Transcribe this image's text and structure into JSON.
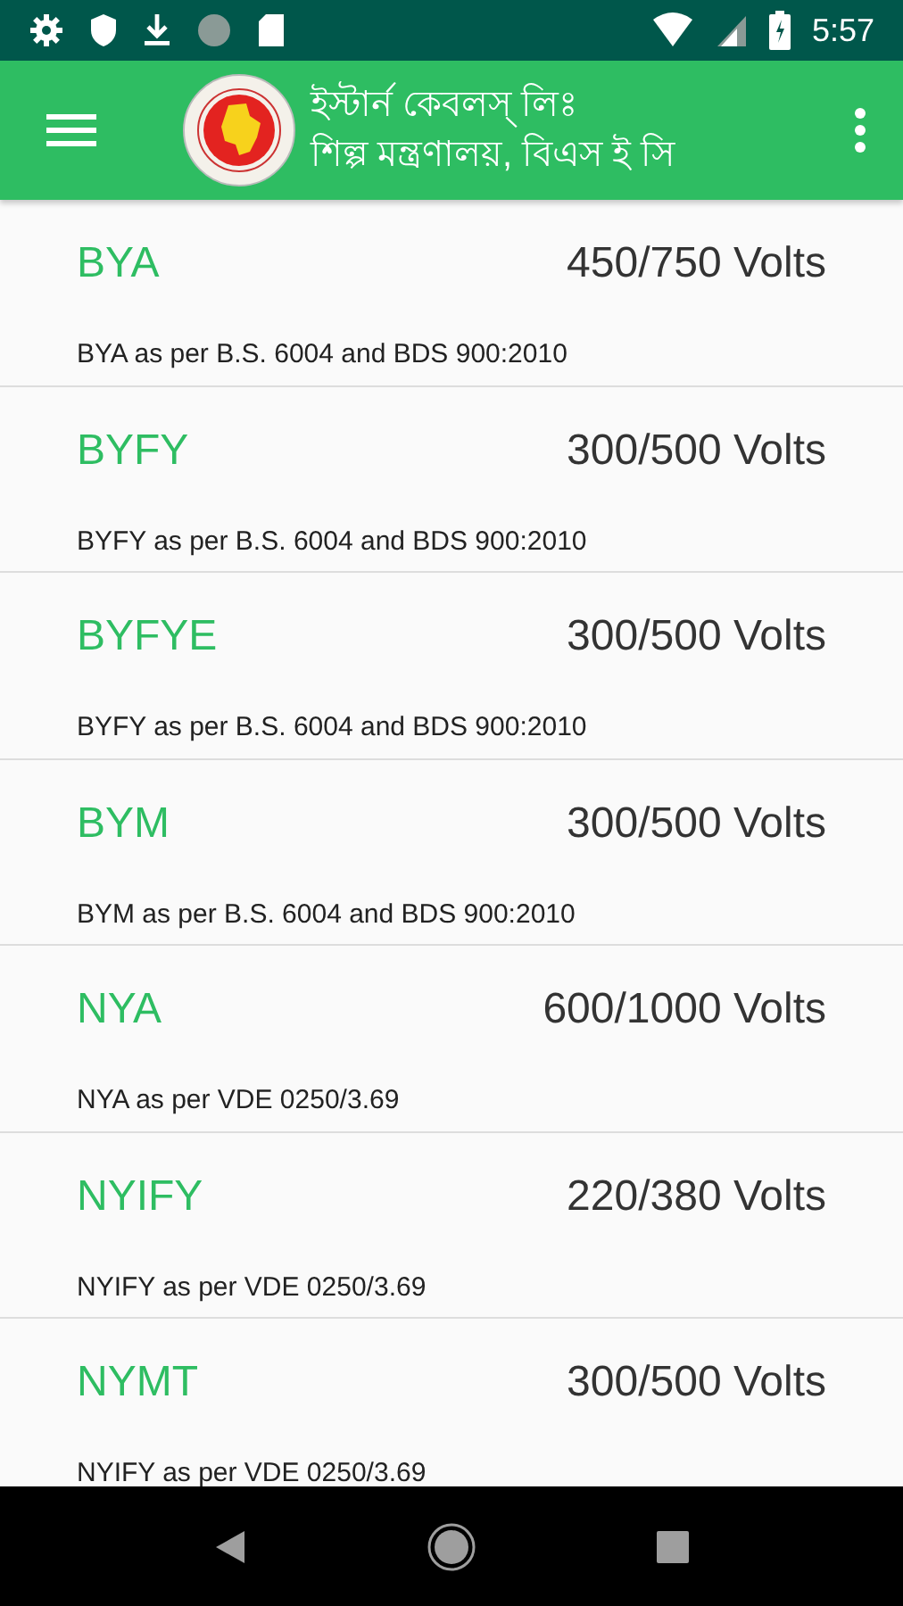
{
  "status_bar": {
    "time": "5:57"
  },
  "app_bar": {
    "title": "ইস্টার্ন কেবলস্ লিঃ",
    "subtitle": "শিল্প মন্ত্রণালয়, বিএস ই সি"
  },
  "items": [
    {
      "code": "BYA",
      "voltage": "450/750 Volts",
      "description": "BYA as per B.S. 6004 and BDS 900:2010"
    },
    {
      "code": "BYFY",
      "voltage": "300/500 Volts",
      "description": "BYFY as per B.S. 6004 and BDS 900:2010"
    },
    {
      "code": "BYFYE",
      "voltage": "300/500 Volts",
      "description": "BYFY as per B.S. 6004 and BDS 900:2010"
    },
    {
      "code": "BYM",
      "voltage": "300/500 Volts",
      "description": "BYM as per B.S. 6004 and BDS 900:2010"
    },
    {
      "code": "NYA",
      "voltage": "600/1000 Volts",
      "description": "NYA as per VDE 0250/3.69"
    },
    {
      "code": "NYIFY",
      "voltage": "220/380 Volts",
      "description": "NYIFY as per VDE 0250/3.69"
    },
    {
      "code": "NYMT",
      "voltage": "300/500 Volts",
      "description": "NYIFY as per VDE 0250/3.69"
    }
  ]
}
